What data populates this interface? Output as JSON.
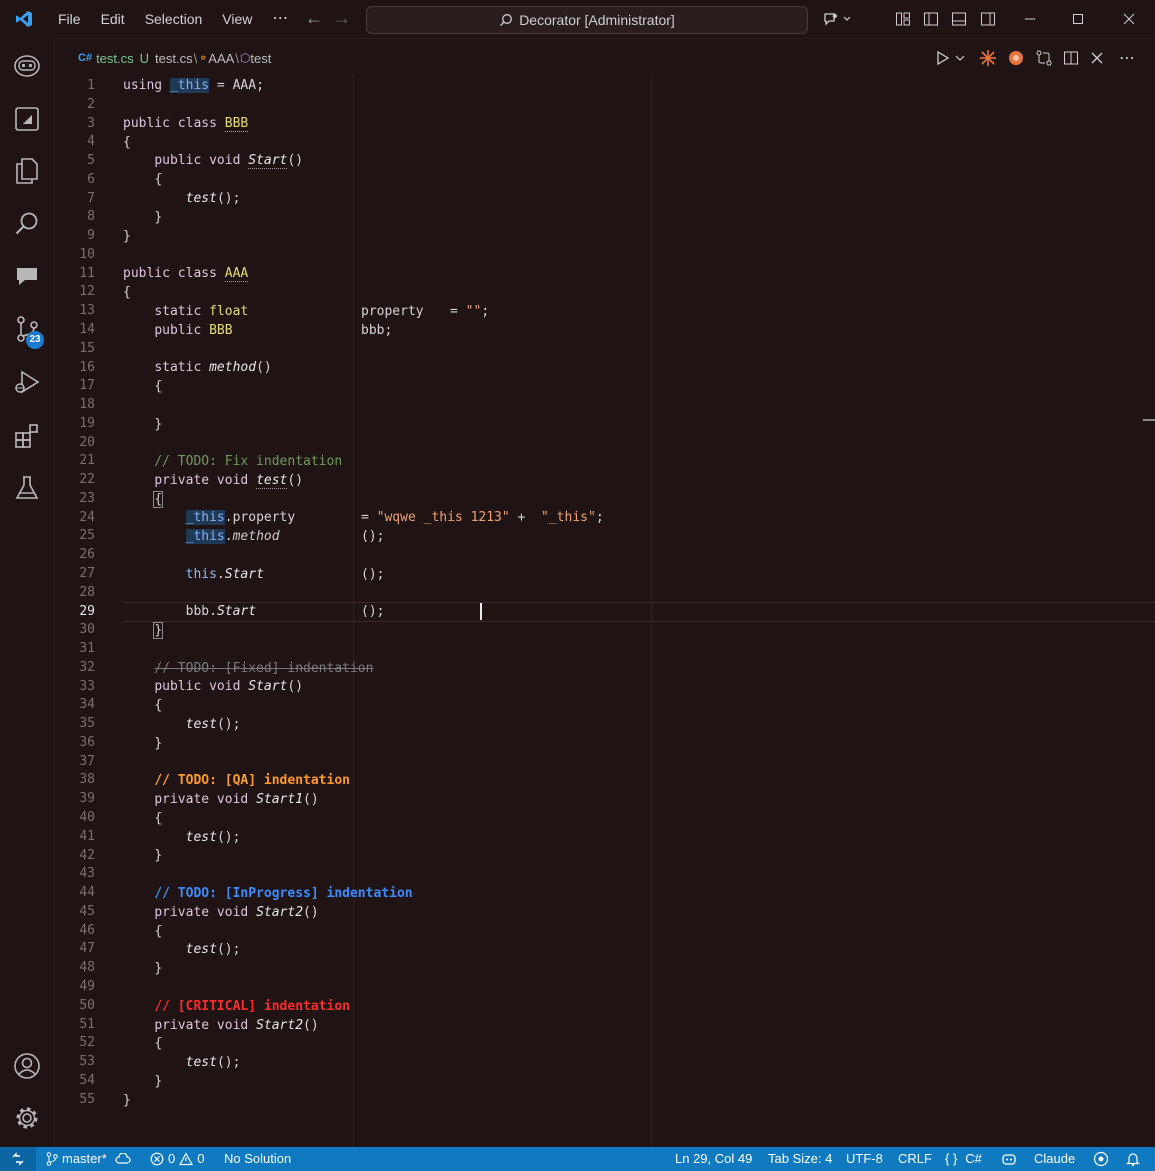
{
  "titlebar": {
    "menu": [
      "File",
      "Edit",
      "Selection",
      "View"
    ],
    "more": "⋯",
    "command_center": "Decorator [Administrator]"
  },
  "breadcrumb": {
    "file": "test.cs",
    "status": "U",
    "path_file": "test.cs",
    "class": "AAA",
    "member": "test"
  },
  "activity": {
    "scm_badge": "23",
    "icons": [
      "copilot-icon",
      "panel-icon",
      "explorer-icon",
      "search-icon",
      "chat-icon",
      "source-control-icon",
      "run-debug-icon",
      "extensions-icon",
      "testing-icon",
      "account-icon",
      "settings-gear-icon"
    ]
  },
  "editor": {
    "active_line": 29,
    "lines": [
      "1",
      "2",
      "3",
      "4",
      "5",
      "6",
      "7",
      "8",
      "9",
      "10",
      "11",
      "12",
      "13",
      "14",
      "15",
      "16",
      "17",
      "18",
      "19",
      "20",
      "21",
      "22",
      "23",
      "24",
      "25",
      "26",
      "27",
      "28",
      "29",
      "30",
      "31",
      "32",
      "33",
      "34",
      "35",
      "36",
      "37",
      "38",
      "39",
      "40",
      "41",
      "42",
      "43",
      "44",
      "45",
      "46",
      "47",
      "48",
      "49",
      "50",
      "51",
      "52",
      "53",
      "54",
      "55"
    ],
    "code": {
      "l1_using": "using",
      "l1_this": "_this",
      "l1_rest": " = AAA;",
      "l3_kw": "public class",
      "l3_name": "BBB",
      "brace_open": "{",
      "brace_close": "}",
      "l5_kw": "public void",
      "l5_fn": "Start",
      "l5_paren": "()",
      "l7_fn": "test",
      "l7_rest": "();",
      "l11_kw": "public class",
      "l11_name": "AAA",
      "l13_kw": "static",
      "l13_ty": "float",
      "l13_name": "property",
      "l13_eq": "= ",
      "l13_str": "\"\"",
      "l13_end": ";",
      "l14_kw": "public",
      "l14_ty": "BBB",
      "l14_name": "bbb;",
      "l16_kw": "static",
      "l16_fn": "method",
      "l16_paren": "()",
      "l21_cmt": "// TODO: Fix indentation",
      "l22_kw": "private void",
      "l22_fn": "test",
      "l22_paren": "()",
      "l24_this": "_this",
      "l24_member": ".property",
      "l24_eq": "= ",
      "l24_str1": "\"wqwe _this 1213\"",
      "l24_plus": " +  ",
      "l24_str2": "\"_this\"",
      "l24_end": ";",
      "l25_this": "_this",
      "l25_dot": ".",
      "l25_fn": "method",
      "l25_call": "();",
      "l27_this": "this",
      "l27_dot": ".",
      "l27_fn": "Start",
      "l27_call": "();",
      "l29_obj": "bbb",
      "l29_dot": ".",
      "l29_fn": "Start",
      "l29_call": "();",
      "l32_cmt": "// TODO: [Fixed] indentation",
      "l33_kw": "public void",
      "l33_fn": "Start",
      "l33_paren": "()",
      "l38_cmt": "// TODO: [QA] indentation",
      "l39_kw": "private void",
      "l39_fn": "Start1",
      "l39_paren": "()",
      "l44_cmt": "// TODO: [InProgress] indentation",
      "l45_kw": "private void",
      "l45_fn": "Start2",
      "l45_paren": "()",
      "l50_cmt": "// [CRITICAL] indentation",
      "l51_kw": "private void",
      "l51_fn": "Start2",
      "l51_paren": "()",
      "call_test": "test",
      "call_rest": "();"
    }
  },
  "statusbar": {
    "branch": "master*",
    "errors": "0",
    "warnings": "0",
    "solution": "No Solution",
    "position": "Ln 29, Col 49",
    "tab_size": "Tab Size: 4",
    "encoding": "UTF-8",
    "eol": "CRLF",
    "language": "C#",
    "language_icon": "{ }",
    "claude": "Claude"
  },
  "colors": {
    "accent": "#0f7ac0",
    "background": "#1f1313",
    "todo_default": "#6f9a5a",
    "todo_qa": "#ff9a2e",
    "todo_inprogress": "#3a8cff",
    "todo_critical": "#ff2a2a"
  }
}
